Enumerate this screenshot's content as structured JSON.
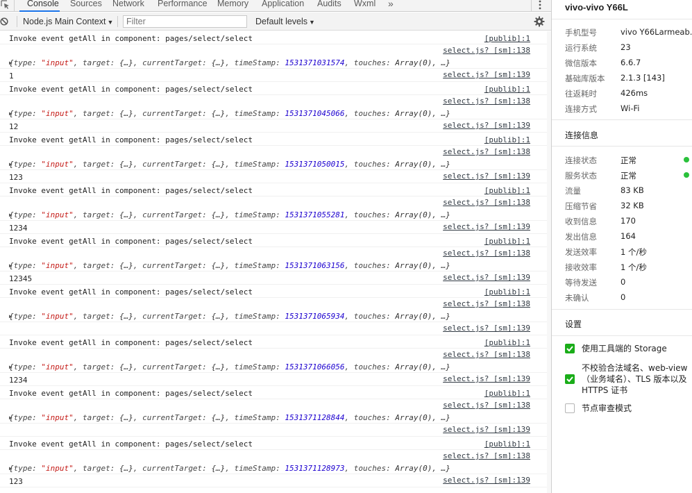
{
  "tabs": [
    {
      "label": "Console",
      "active": true
    },
    {
      "label": "Sources"
    },
    {
      "label": "Network"
    },
    {
      "label": "Performance"
    },
    {
      "label": "Memory"
    },
    {
      "label": "Application"
    },
    {
      "label": "Audits"
    },
    {
      "label": "Wxml"
    }
  ],
  "tabs_overflow": "»",
  "toolbar": {
    "context": "Node.js Main Context",
    "filter_placeholder": "Filter",
    "levels": "Default levels"
  },
  "log": [
    {
      "type": "invoke",
      "text": "Invoke event getAll in component: pages/select/select",
      "source": "[publib]:1"
    },
    {
      "type": "event",
      "source": "select.js? [sm]:138",
      "timeStamp": "1531371031574"
    },
    {
      "type": "value",
      "text": "1",
      "source": "select.js? [sm]:139"
    },
    {
      "type": "invoke",
      "text": "Invoke event getAll in component: pages/select/select",
      "source": "[publib]:1"
    },
    {
      "type": "event",
      "source": "select.js? [sm]:138",
      "timeStamp": "1531371045066"
    },
    {
      "type": "value",
      "text": "12",
      "source": "select.js? [sm]:139"
    },
    {
      "type": "invoke",
      "text": "Invoke event getAll in component: pages/select/select",
      "source": "[publib]:1"
    },
    {
      "type": "event",
      "source": "select.js? [sm]:138",
      "timeStamp": "1531371050015"
    },
    {
      "type": "value",
      "text": "123",
      "source": "select.js? [sm]:139"
    },
    {
      "type": "invoke",
      "text": "Invoke event getAll in component: pages/select/select",
      "source": "[publib]:1"
    },
    {
      "type": "event",
      "source": "select.js? [sm]:138",
      "timeStamp": "1531371055281"
    },
    {
      "type": "value",
      "text": "1234",
      "source": "select.js? [sm]:139"
    },
    {
      "type": "invoke",
      "text": "Invoke event getAll in component: pages/select/select",
      "source": "[publib]:1"
    },
    {
      "type": "event",
      "source": "select.js? [sm]:138",
      "timeStamp": "1531371063156"
    },
    {
      "type": "value",
      "text": "12345",
      "source": "select.js? [sm]:139"
    },
    {
      "type": "invoke",
      "text": "Invoke event getAll in component: pages/select/select",
      "source": "[publib]:1"
    },
    {
      "type": "event",
      "source": "select.js? [sm]:138",
      "timeStamp": "1531371065934"
    },
    {
      "type": "value",
      "text": "",
      "source": "select.js? [sm]:139"
    },
    {
      "type": "invoke",
      "text": "Invoke event getAll in component: pages/select/select",
      "source": "[publib]:1"
    },
    {
      "type": "event",
      "source": "select.js? [sm]:138",
      "timeStamp": "1531371066056"
    },
    {
      "type": "value",
      "text": "1234",
      "source": "select.js? [sm]:139"
    },
    {
      "type": "invoke",
      "text": "Invoke event getAll in component: pages/select/select",
      "source": "[publib]:1"
    },
    {
      "type": "event",
      "source": "select.js? [sm]:138",
      "timeStamp": "1531371128844"
    },
    {
      "type": "value",
      "text": "",
      "source": "select.js? [sm]:139"
    },
    {
      "type": "invoke",
      "text": "Invoke event getAll in component: pages/select/select",
      "source": "[publib]:1"
    },
    {
      "type": "event",
      "source": "select.js? [sm]:138",
      "timeStamp": "1531371128973"
    },
    {
      "type": "value",
      "text": "123",
      "source": "select.js? [sm]:139"
    }
  ],
  "event_obj": {
    "open": "{",
    "k_type": "type: ",
    "type_val": "\"input\"",
    "k_target": ", target: ",
    "target_val": "{…}",
    "k_current": ", currentTarget: ",
    "current_val": "{…}",
    "k_ts": ", timeStamp: ",
    "k_touches": ", touches: ",
    "touches_val": "Array(0)",
    "close": ", …}"
  },
  "panel": {
    "device_title": "vivo-vivo Y66L",
    "device_info": [
      {
        "label": "手机型号",
        "value": "vivo Y66Larmeab..."
      },
      {
        "label": "运行系统",
        "value": "23"
      },
      {
        "label": "微信版本",
        "value": "6.6.7"
      },
      {
        "label": "基础库版本",
        "value": "2.1.3 [143]"
      },
      {
        "label": "往返耗时",
        "value": "426ms"
      },
      {
        "label": "连接方式",
        "value": "Wi-Fi"
      }
    ],
    "connection_title": "连接信息",
    "connection_info": [
      {
        "label": "连接状态",
        "value": "正常",
        "dot": true
      },
      {
        "label": "服务状态",
        "value": "正常",
        "dot": true
      },
      {
        "label": "流量",
        "value": "83 KB"
      },
      {
        "label": "压缩节省",
        "value": "32 KB"
      },
      {
        "label": "收到信息",
        "value": "170"
      },
      {
        "label": "发出信息",
        "value": "164"
      },
      {
        "label": "发送效率",
        "value": "1 个/秒"
      },
      {
        "label": "接收效率",
        "value": "1 个/秒"
      },
      {
        "label": "等待发送",
        "value": "0"
      },
      {
        "label": "未确认",
        "value": "0"
      }
    ],
    "settings_title": "设置",
    "settings": [
      {
        "label": "使用工具端的 Storage",
        "checked": true
      },
      {
        "label": "不校验合法域名、web-view（业务域名）、TLS 版本以及 HTTPS 证书",
        "checked": true
      },
      {
        "label": "节点审查模式",
        "checked": false
      }
    ],
    "status_color": "#2ac13b",
    "checkbox_color": "#1aad19"
  }
}
